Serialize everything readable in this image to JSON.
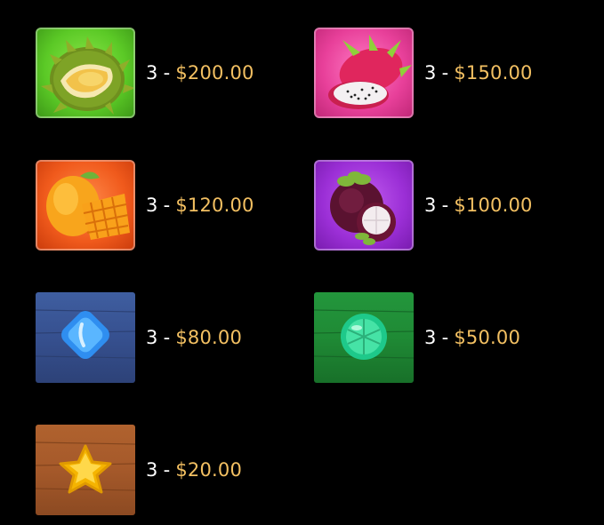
{
  "paytable": [
    {
      "symbol": "durian",
      "count": "3",
      "dash": "-",
      "amount": "$200.00",
      "color": "#5bc926"
    },
    {
      "symbol": "dragon-fruit",
      "count": "3",
      "dash": "-",
      "amount": "$150.00",
      "color": "#e8409a"
    },
    {
      "symbol": "mango",
      "count": "3",
      "dash": "-",
      "amount": "$120.00",
      "color": "#f05a1c"
    },
    {
      "symbol": "mangosteen",
      "count": "3",
      "dash": "-",
      "amount": "$100.00",
      "color": "#9b2fd6"
    },
    {
      "symbol": "blue-candy",
      "count": "3",
      "dash": "-",
      "amount": "$80.00",
      "color": "#36508f"
    },
    {
      "symbol": "green-candy",
      "count": "3",
      "dash": "-",
      "amount": "$50.00",
      "color": "#1f8a35"
    },
    {
      "symbol": "star-candy",
      "count": "3",
      "dash": "-",
      "amount": "$20.00",
      "color": "#a5592a"
    }
  ],
  "colors": {
    "background": "#000000",
    "amount_text": "#f3c062",
    "count_text": "#ffffff"
  }
}
